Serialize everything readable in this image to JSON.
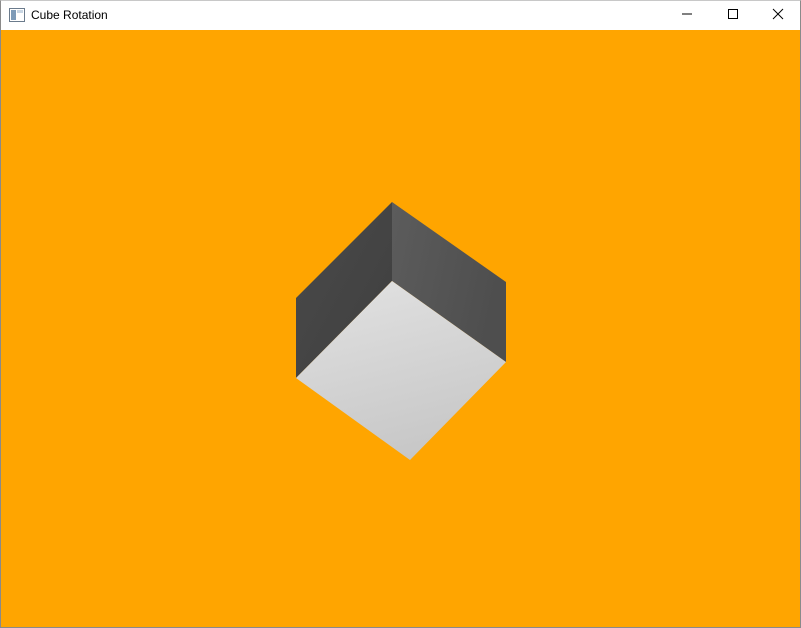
{
  "window": {
    "title": "Cube Rotation",
    "icon": "app-window-icon",
    "controls": {
      "minimize_icon": "minimize-icon",
      "maximize_icon": "maximize-icon",
      "close_icon": "close-icon"
    }
  },
  "scene": {
    "background_color": "#FFA500",
    "object": "cube",
    "faces": {
      "top_left_color": "#474747",
      "top_right_color": "#555555",
      "front_color": "#d6d6d6"
    }
  }
}
